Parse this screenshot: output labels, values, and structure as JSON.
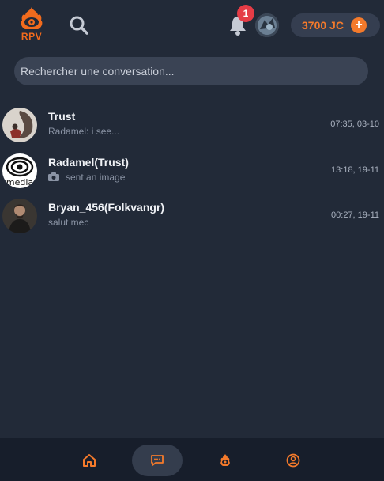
{
  "header": {
    "logo_text": "RPV",
    "notifications_count": "1",
    "coins_label": "3700 JC",
    "coins_add": "+"
  },
  "search": {
    "placeholder": "Rechercher une conversation..."
  },
  "conversations": [
    {
      "name": "Trust",
      "last_message": "Radamel: i see...",
      "time": "07:35, 03-10"
    },
    {
      "name": "Radamel(Trust)",
      "last_message": "sent an image",
      "time": "13:18, 19-11"
    },
    {
      "name": "Bryan_456(Folkvangr)",
      "last_message": "salut mec",
      "time": "00:27, 19-11"
    }
  ],
  "avatar_text": {
    "media": "media"
  },
  "colors": {
    "accent": "#f47a2b",
    "background": "#222a38",
    "nav_background": "#171e2b",
    "badge": "#e53c46"
  },
  "bottom_nav": {
    "items": [
      "home-icon",
      "chat-icon",
      "faction-icon",
      "profile-icon"
    ],
    "active": "chat-icon"
  }
}
